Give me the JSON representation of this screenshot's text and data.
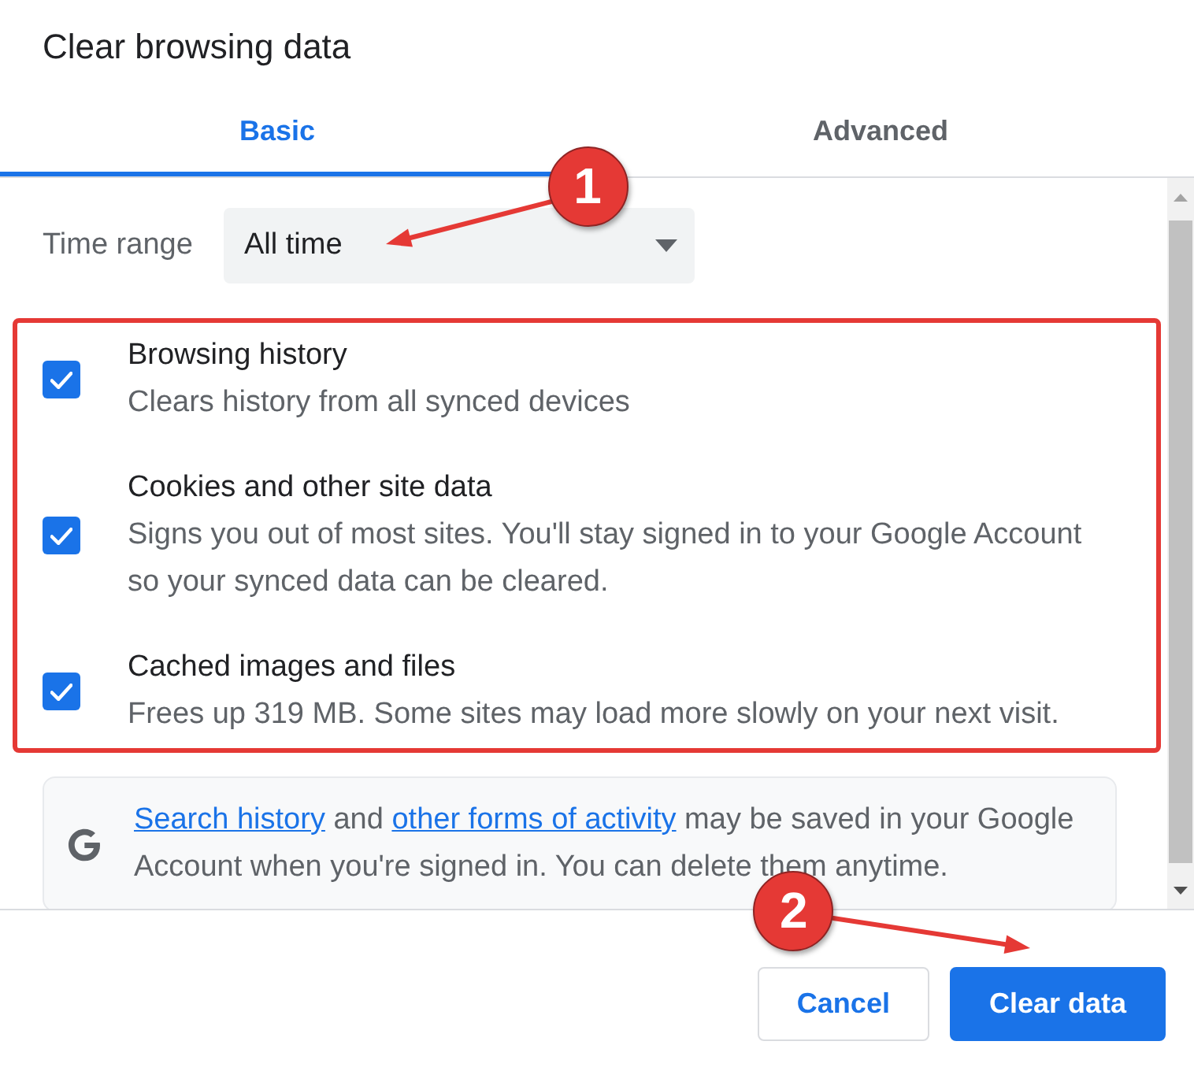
{
  "dialog_title": "Clear browsing data",
  "tabs": [
    {
      "label": "Basic",
      "selected": true
    },
    {
      "label": "Advanced",
      "selected": false
    }
  ],
  "time_range": {
    "label": "Time range",
    "value": "All time",
    "marker": "1"
  },
  "options_highlighted": true,
  "options": [
    {
      "title": "Browsing history",
      "description": "Clears history from all synced devices",
      "checked": true
    },
    {
      "title": "Cookies and other site data",
      "description": "Signs you out of most sites. You'll stay signed in to your Google Account so your synced data can be cleared.",
      "checked": true
    },
    {
      "title": "Cached images and files",
      "description": "Frees up 319 MB. Some sites may load more slowly on your next visit.",
      "checked": true
    }
  ],
  "notice": {
    "parts": [
      {
        "kind": "link",
        "text": "Search history"
      },
      {
        "kind": "text",
        "text": " and "
      },
      {
        "kind": "link",
        "text": "other forms of activity"
      },
      {
        "kind": "text",
        "text": " may be saved in your Google Account when you're signed in. You can delete them anytime."
      }
    ]
  },
  "buttons": [
    {
      "label": "Cancel",
      "kind": "secondary"
    },
    {
      "label": "Clear data",
      "kind": "primary",
      "marker": "2"
    }
  ]
}
